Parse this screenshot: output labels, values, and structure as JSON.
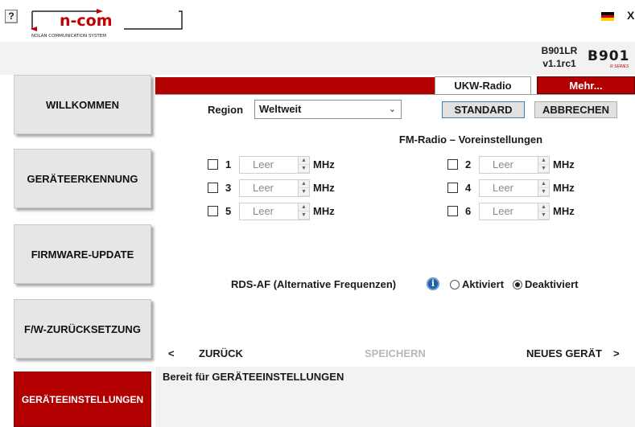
{
  "topbar": {
    "help_label": "?",
    "logo_main": "n-com",
    "logo_sub": "NOLAN COMMUNICATION SYSTEM",
    "close_label": "X",
    "flag_colors": [
      "#000000",
      "#dd0000",
      "#ffce00"
    ],
    "flag_icon": "flag-de-icon"
  },
  "device": {
    "model": "B901LR",
    "version": "v1.1rc1",
    "logo_text": "B901",
    "logo_sub": "R SERIES"
  },
  "sidebar": {
    "items": [
      {
        "label": "WILLKOMMEN",
        "active": false
      },
      {
        "label": "GERÄTEERKENNUNG",
        "active": false
      },
      {
        "label": "FIRMWARE-UPDATE",
        "active": false
      },
      {
        "label": "F/W-ZURÜCKSETZUNG",
        "active": false
      },
      {
        "label": "GERÄTEEINSTELLUNGEN",
        "active": true
      }
    ]
  },
  "tabs": {
    "active_label": "UKW-Radio",
    "more_label": "Mehr..."
  },
  "region": {
    "label": "Region",
    "value": "Weltweit"
  },
  "buttons": {
    "standard": "STANDARD",
    "abbrechen": "ABBRECHEN"
  },
  "presets": {
    "title": "FM-Radio – Voreinstellungen",
    "unit": "MHz",
    "items": [
      {
        "num": "1",
        "value": "Leer",
        "checked": false
      },
      {
        "num": "2",
        "value": "Leer",
        "checked": false
      },
      {
        "num": "3",
        "value": "Leer",
        "checked": false
      },
      {
        "num": "4",
        "value": "Leer",
        "checked": false
      },
      {
        "num": "5",
        "value": "Leer",
        "checked": false
      },
      {
        "num": "6",
        "value": "Leer",
        "checked": false
      }
    ]
  },
  "rds": {
    "label": "RDS-AF (Alternative Frequenzen)",
    "info_icon": "info-icon",
    "option_on": "Aktiviert",
    "option_off": "Deaktiviert",
    "selected": "Deaktiviert"
  },
  "nav": {
    "back_arrow": "<",
    "back": "ZURÜCK",
    "save": "SPEICHERN",
    "new_device": "NEUES GERÄT",
    "new_arrow": ">"
  },
  "status": {
    "text": "Bereit für GERÄTEEINSTELLUNGEN"
  },
  "colors": {
    "accent_red": "#b20000",
    "status_bg": "#f2f2f2",
    "disabled_text": "#b8b8b8"
  }
}
